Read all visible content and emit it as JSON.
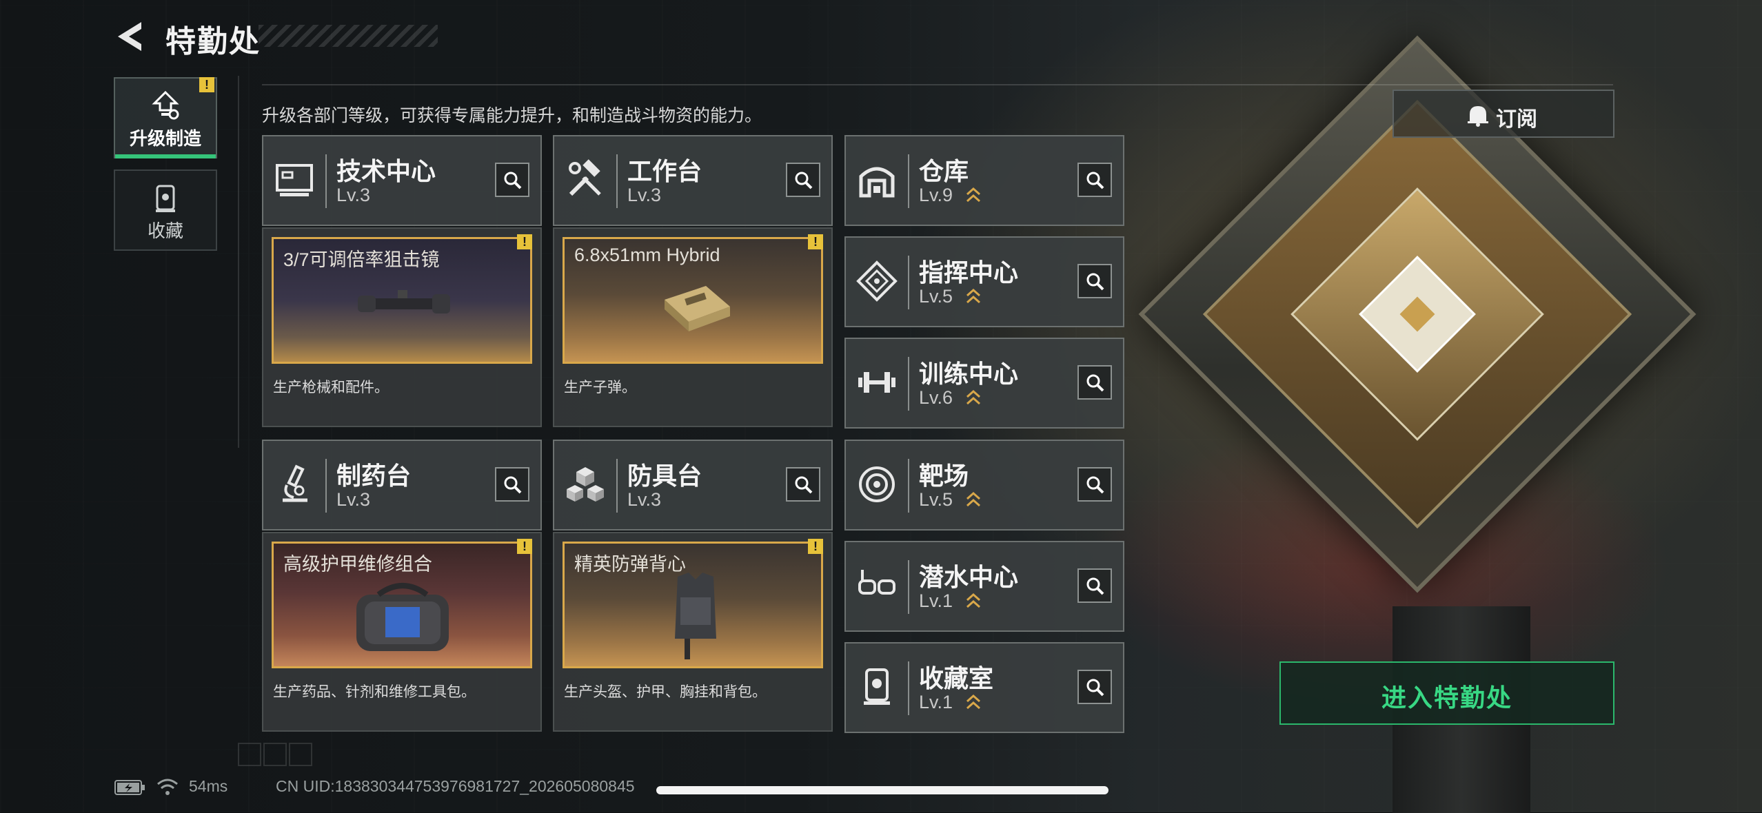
{
  "header": {
    "title": "特勤处"
  },
  "sidebar": {
    "items": [
      {
        "label": "升级制造",
        "active": true,
        "alert": "!"
      },
      {
        "label": "收藏",
        "active": false
      }
    ]
  },
  "subtitle": "升级各部门等级，可获得专属能力提升，和制造战斗物资的能力。",
  "departments": {
    "tech": {
      "name": "技术中心",
      "level": "Lv.3",
      "product": {
        "caption": "3/7可调倍率狙击镜",
        "desc": "生产枪械和配件。",
        "alert": "!"
      }
    },
    "workbench": {
      "name": "工作台",
      "level": "Lv.3",
      "product": {
        "caption": "6.8x51mm Hybrid",
        "desc": "生产子弹。",
        "alert": "!"
      }
    },
    "pharmacy": {
      "name": "制药台",
      "level": "Lv.3",
      "product": {
        "caption": "高级护甲维修组合",
        "desc": "生产药品、针剂和维修工具包。",
        "alert": "!"
      }
    },
    "armor": {
      "name": "防具台",
      "level": "Lv.3",
      "product": {
        "caption": "精英防弹背心",
        "desc": "生产头盔、护甲、胸挂和背包。",
        "alert": "!"
      }
    },
    "warehouse": {
      "name": "仓库",
      "level": "Lv.9"
    },
    "command": {
      "name": "指挥中心",
      "level": "Lv.5"
    },
    "training": {
      "name": "训练中心",
      "level": "Lv.6"
    },
    "range": {
      "name": "靶场",
      "level": "Lv.5"
    },
    "diving": {
      "name": "潜水中心",
      "level": "Lv.1"
    },
    "collection": {
      "name": "收藏室",
      "level": "Lv.1"
    }
  },
  "right_panel": {
    "subscribe_label": "订阅",
    "enter_label": "进入特勤处"
  },
  "status_bar": {
    "ping": "54ms",
    "uid": "CN UID:1838303447539769817​27_20260508​0845"
  },
  "colors": {
    "accent_green": "#38d884",
    "alert_yellow": "#e7c23a",
    "card_frame_gold": "#d9a84a"
  }
}
